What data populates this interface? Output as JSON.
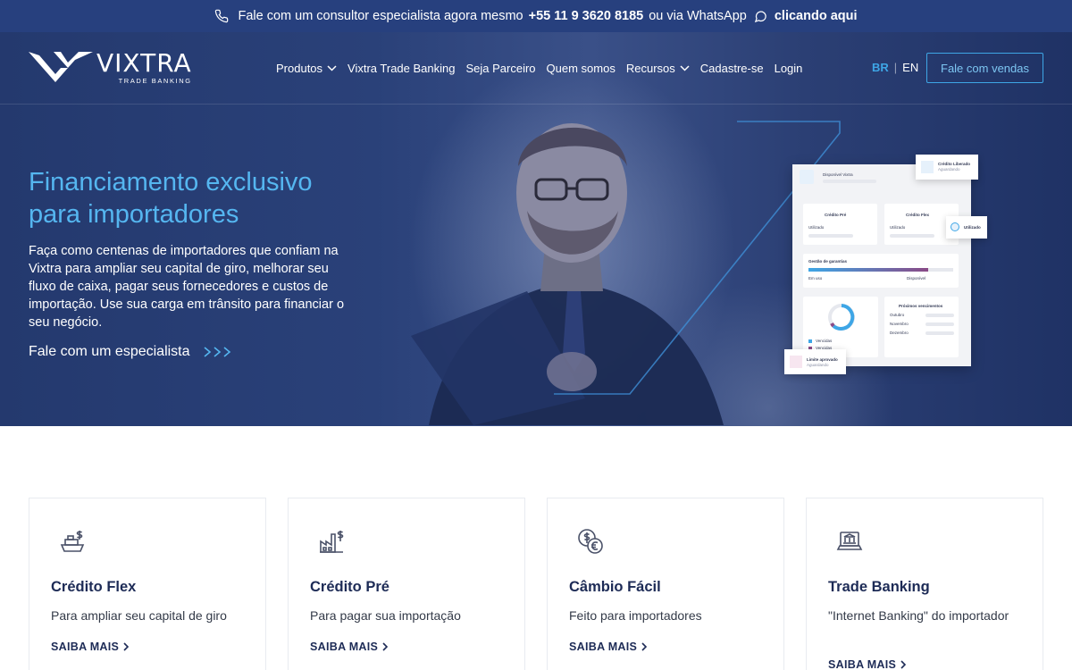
{
  "topbar": {
    "text_before": "Fale com um consultor especialista agora mesmo",
    "phone": "+55 11 9 3620 8185",
    "text_middle": "ou via WhatsApp",
    "whatsapp_link": "clicando aqui"
  },
  "logo": {
    "name": "VIXTRA",
    "subtitle": "TRADE BANKING"
  },
  "nav": {
    "items": [
      {
        "label": "Produtos",
        "dropdown": true
      },
      {
        "label": "Vixtra Trade Banking",
        "dropdown": false
      },
      {
        "label": "Seja Parceiro",
        "dropdown": false
      },
      {
        "label": "Quem somos",
        "dropdown": false
      },
      {
        "label": "Recursos",
        "dropdown": true
      },
      {
        "label": "Cadastre-se",
        "dropdown": false
      },
      {
        "label": "Login",
        "dropdown": false
      }
    ],
    "lang_active": "BR",
    "lang_other": "EN",
    "cta": "Fale com vendas"
  },
  "hero": {
    "title": "Financiamento exclusivo para importadores",
    "body": "Faça como centenas de importadores que confiam na Vixtra para ampliar seu capital de giro, melhorar seu fluxo de caixa, pagar seus fornecedores e custos de importação. Use sua carga em trânsito para financiar o seu negócio.",
    "link": "Fale com um especialista",
    "link_arrows": "›››"
  },
  "dashboard": {
    "header": "Disponível Vixtra",
    "credit_approved": "Crédito Liberado",
    "credit_approved_sub": "Aguardando",
    "credito_pre": "Crédito Pré",
    "credito_flex": "Crédito Flex",
    "utilizado": "Utilizado",
    "utilizado_label": "Utilizado",
    "gestao": "Gestão de garantias",
    "em_uso": "Em uso",
    "disponivel": "Disponível",
    "proximos": "Próximos vencimentos",
    "months": [
      "Outubro",
      "Novembro",
      "Dezembro"
    ],
    "vencidas": "Vencidas",
    "a_vencer": "Vencidas",
    "limite": "Limite aprovado",
    "limite_sub": "Aguardando",
    "gestao_fill": 0.83
  },
  "colors": {
    "accent": "#3ea6e6",
    "topbar": "#27407e",
    "card_title": "#1d2b56"
  },
  "cards": [
    {
      "icon": "ship-dollar-icon",
      "title": "Crédito Flex",
      "desc": "Para ampliar seu capital de giro",
      "more": "SAIBA MAIS"
    },
    {
      "icon": "factory-dollar-icon",
      "title": "Crédito Pré",
      "desc": "Para pagar sua importação",
      "more": "SAIBA MAIS"
    },
    {
      "icon": "exchange-coins-icon",
      "title": "Câmbio Fácil",
      "desc": "Feito para importadores",
      "more": "SAIBA MAIS"
    },
    {
      "icon": "laptop-bank-icon",
      "title": "Trade Banking",
      "desc": "\"Internet Banking\" do importador",
      "more": "SAIBA MAIS"
    }
  ]
}
